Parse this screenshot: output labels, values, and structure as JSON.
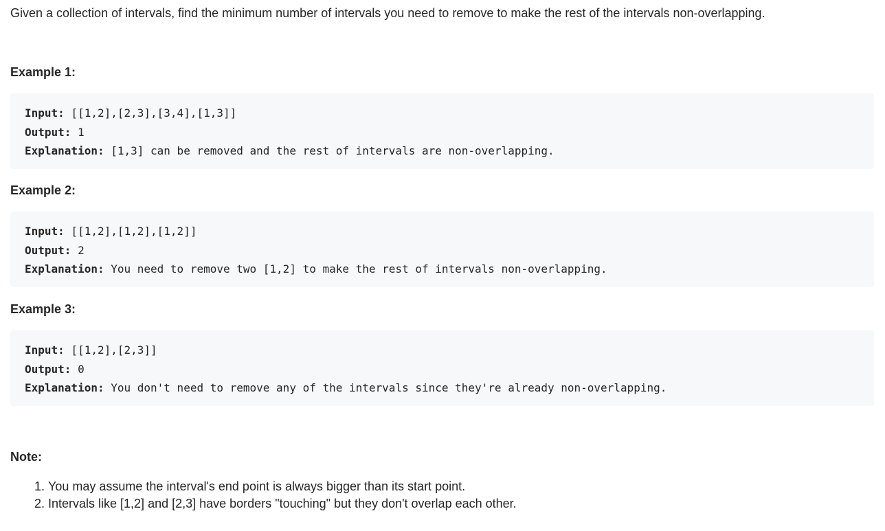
{
  "intro": "Given a collection of intervals, find the minimum number of intervals you need to remove to make the rest of the intervals non-overlapping.",
  "examples": [
    {
      "title": "Example 1:",
      "input_label": "Input:",
      "input_value": " [[1,2],[2,3],[3,4],[1,3]]",
      "output_label": "Output:",
      "output_value": " 1",
      "explanation_label": "Explanation:",
      "explanation_value": " [1,3] can be removed and the rest of intervals are non-overlapping."
    },
    {
      "title": "Example 2:",
      "input_label": "Input:",
      "input_value": " [[1,2],[1,2],[1,2]]",
      "output_label": "Output:",
      "output_value": " 2",
      "explanation_label": "Explanation:",
      "explanation_value": " You need to remove two [1,2] to make the rest of intervals non-overlapping."
    },
    {
      "title": "Example 3:",
      "input_label": "Input:",
      "input_value": " [[1,2],[2,3]]",
      "output_label": "Output:",
      "output_value": " 0",
      "explanation_label": "Explanation:",
      "explanation_value": " You don't need to remove any of the intervals since they're already non-overlapping."
    }
  ],
  "note": {
    "title": "Note:",
    "items": [
      {
        "num": "1.",
        "text": "You may assume the interval's end point is always bigger than its start point."
      },
      {
        "num": "2.",
        "text": "Intervals like [1,2] and [2,3] have borders \"touching\" but they don't overlap each other."
      }
    ]
  }
}
